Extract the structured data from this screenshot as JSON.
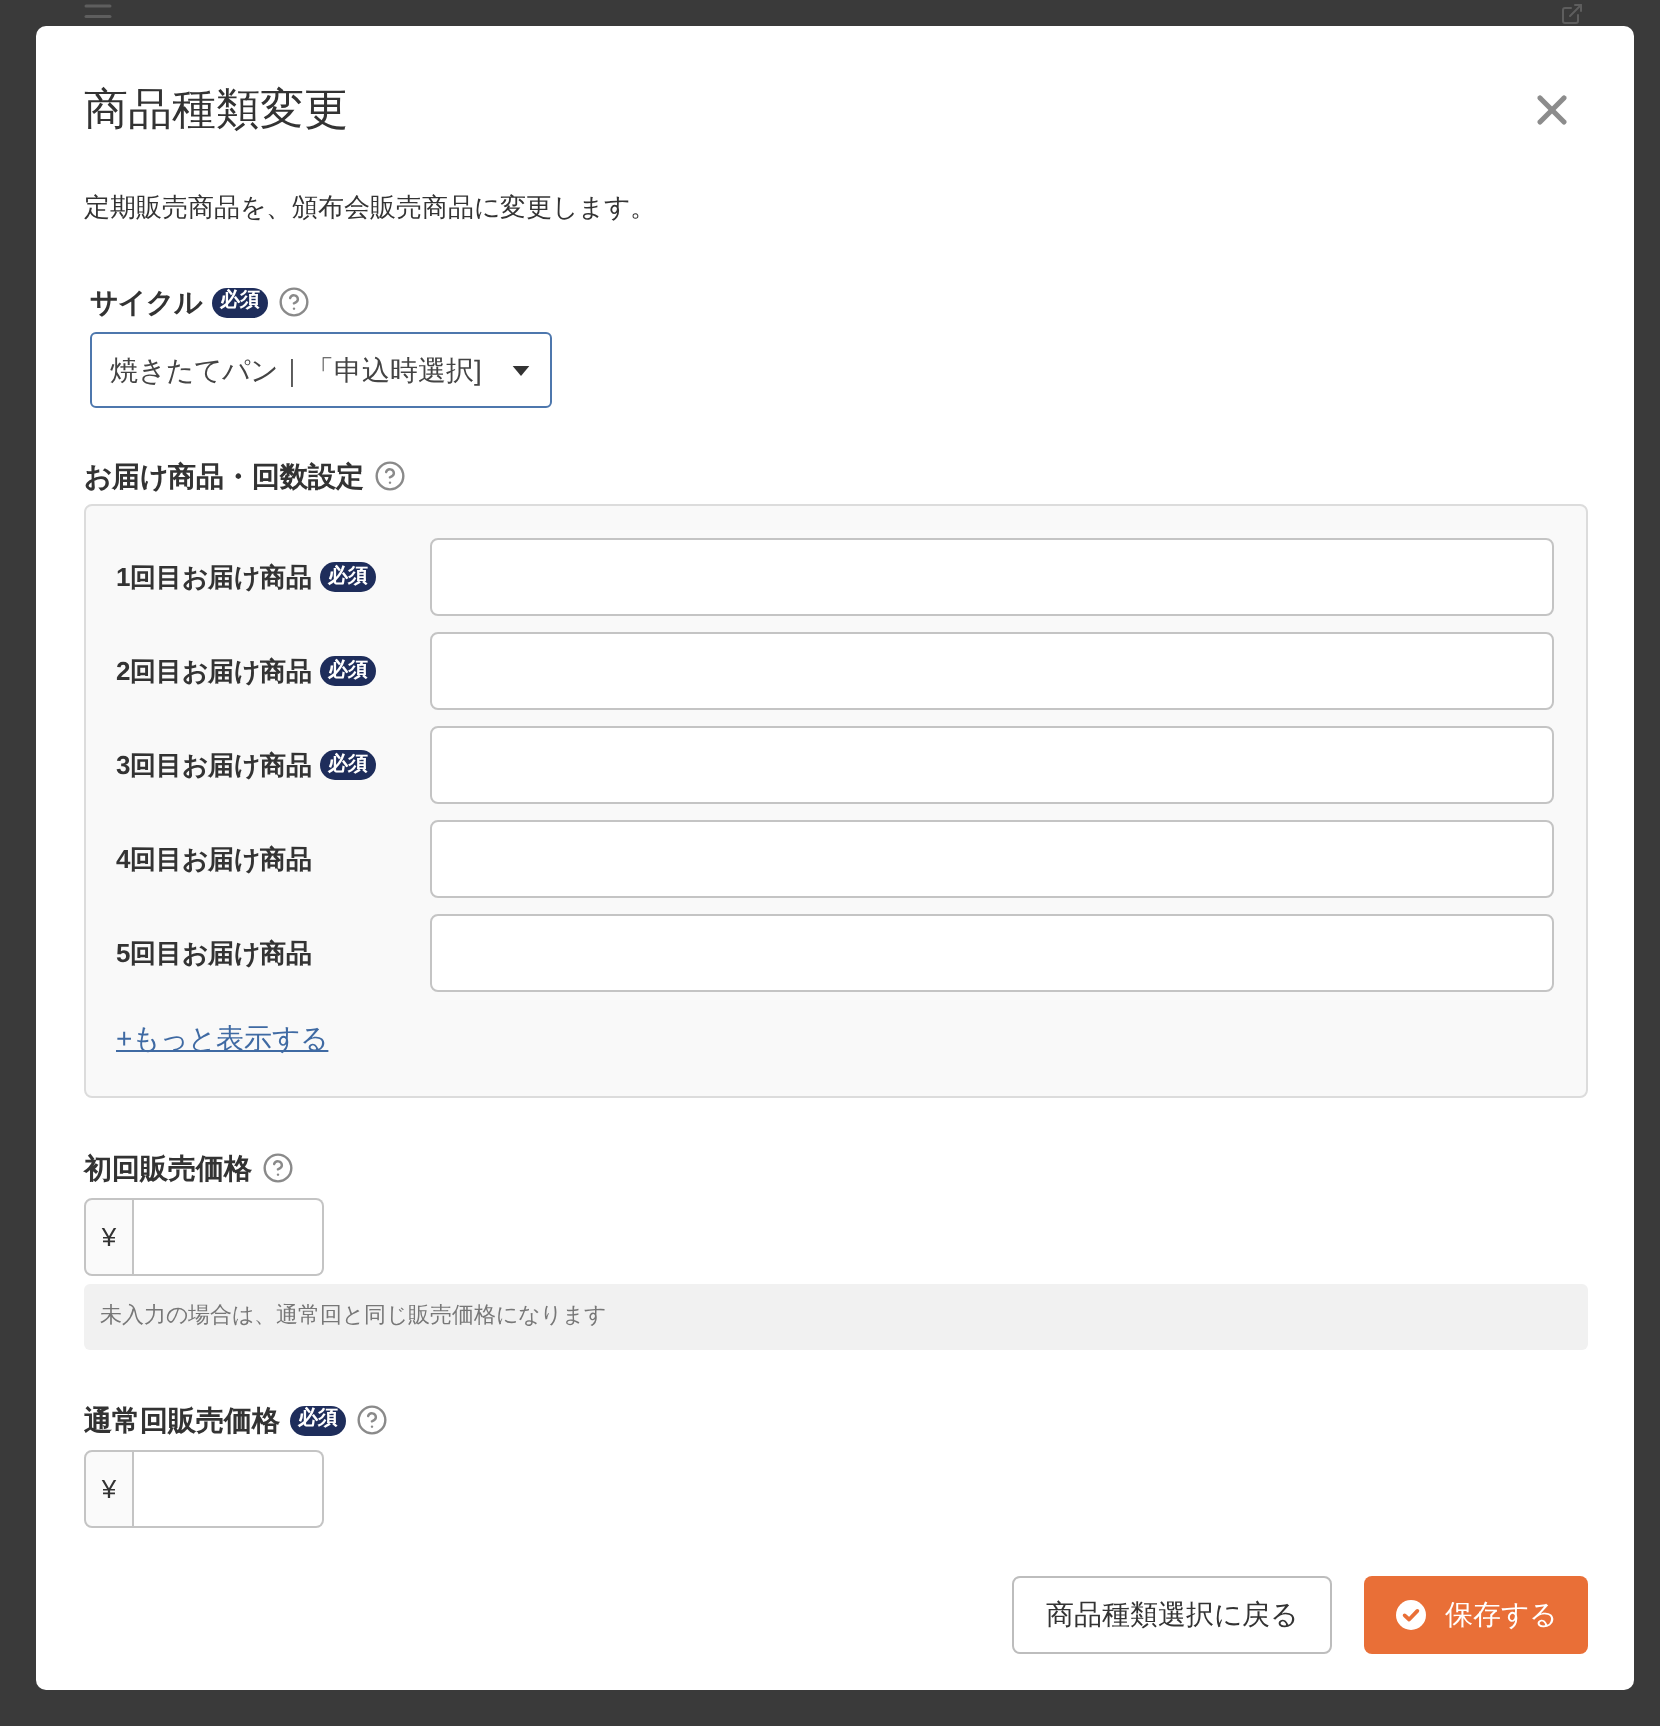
{
  "dialog": {
    "title": "商品種類変更",
    "description": "定期販売商品を、頒布会販売商品に変更します。",
    "cycle": {
      "label": "サイクル",
      "badge": "必須",
      "value": "焼きたてパン｜「申込時選択]"
    },
    "delivery": {
      "label": "お届け商品・回数設定",
      "items": [
        {
          "label": "1回目お届け商品",
          "badge": "必須"
        },
        {
          "label": "2回目お届け商品",
          "badge": "必須"
        },
        {
          "label": "3回目お届け商品",
          "badge": "必須"
        },
        {
          "label": "4回目お届け商品"
        },
        {
          "label": "5回目お届け商品"
        }
      ],
      "more_link": "+もっと表示する"
    },
    "first_price": {
      "label": "初回販売価格",
      "currency": "¥",
      "note": "未入力の場合は、通常回と同じ販売価格になります"
    },
    "regular_price": {
      "label": "通常回販売価格",
      "badge": "必須",
      "currency": "¥"
    },
    "buttons": [
      {
        "label": "商品種類選択に戻る",
        "kind": "secondary"
      },
      {
        "label": "保存する",
        "kind": "primary"
      }
    ]
  }
}
